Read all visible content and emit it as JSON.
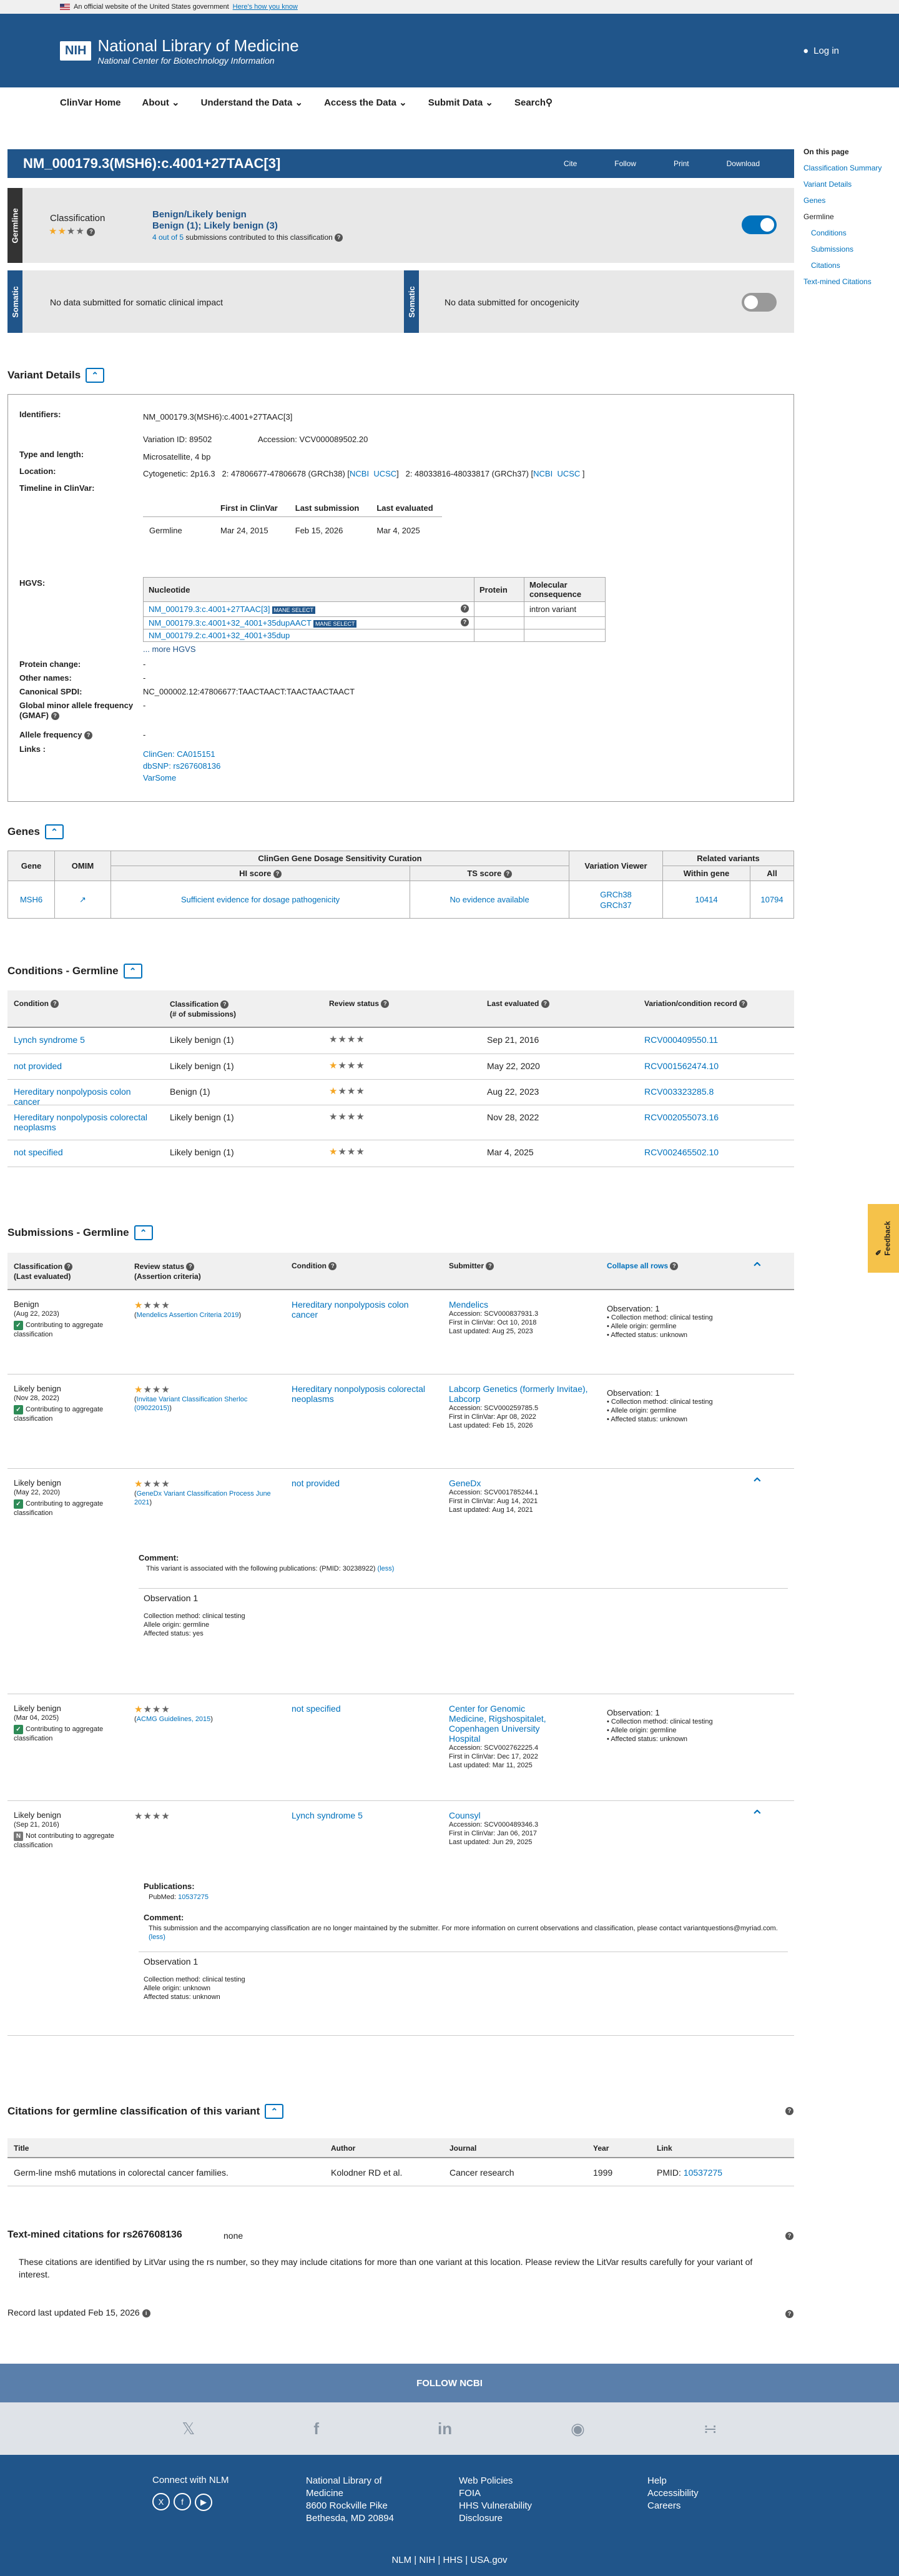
{
  "gov": {
    "text": "An official website of the United States government",
    "link": "Here's how you know"
  },
  "header": {
    "nih": "NIH",
    "name": "National Library of Medicine",
    "sub": "National Center for Biotechnology Information",
    "login": "Log in"
  },
  "nav": [
    "ClinVar Home",
    "About",
    "Understand the Data",
    "Access the Data",
    "Submit Data",
    "Search"
  ],
  "rail": {
    "heading": "On this page",
    "items": [
      "Classification Summary",
      "Variant Details",
      "Genes"
    ],
    "germline": "Germline",
    "sub": [
      "Conditions",
      "Submissions",
      "Citations"
    ],
    "tm": "Text-mined Citations"
  },
  "title": {
    "variant": "NM_000179.3(MSH6):c.4001+27TAAC[3]",
    "actions": [
      "Cite",
      "Follow",
      "Print",
      "Download"
    ]
  },
  "germline": {
    "tab": "Germline",
    "label": "Classification",
    "cls": "Benign/Likely benign",
    "cls2": "Benign (1); Likely benign (3)",
    "subs_link": "4 out of 5",
    "subs_rest": " submissions contributed to this classification"
  },
  "somatic": {
    "tab": "Somatic",
    "clin": "No data submitted for somatic clinical impact",
    "tab2": "Somatic",
    "onco": "No data submitted for oncogenicity"
  },
  "vd": {
    "heading": "Variant Details",
    "identifiers_l": "Identifiers:",
    "identifiers": "NM_000179.3(MSH6):c.4001+27TAAC[3]",
    "vid": "Variation ID: 89502",
    "acc": "Accession: VCV000089502.20",
    "type_l": "Type and length:",
    "type": "Microsatellite, 4 bp",
    "loc_l": "Location:",
    "loc": "Cytogenetic: 2p16.3   2: 47806677-47806678 (GRCh38) [",
    "ncbi": "NCBI",
    "ucsc": "UCSC",
    "loc2": "]   2: 48033816-48033817 (GRCh37) [",
    "timeline_l": "Timeline in ClinVar:",
    "tl_h": [
      "First in ClinVar",
      "Last submission",
      "Last evaluated"
    ],
    "tl_row": [
      "Germline",
      "Mar 24, 2015",
      "Feb 15, 2026",
      "Mar 4, 2025"
    ],
    "hgvs_l": "HGVS:",
    "hgvs_h": [
      "Nucleotide",
      "Protein",
      "Molecular consequence"
    ],
    "hgvs": [
      "NM_000179.3:c.4001+27TAAC[3]",
      "NM_000179.3:c.4001+32_4001+35dupAACT",
      "NM_000179.2:c.4001+32_4001+35dup"
    ],
    "mane": "MANE SELECT",
    "mc": "intron variant",
    "more": "... more HGVS",
    "pc_l": "Protein change:",
    "pc": "-",
    "on_l": "Other names:",
    "on": "-",
    "spdi_l": "Canonical SPDI:",
    "spdi": "NC_000002.12:47806677:TAACTAACT:TAACTAACTAACT",
    "gmaf_l": "Global minor allele frequency (GMAF)",
    "gmaf": "-",
    "af_l": "Allele frequency",
    "af": "-",
    "links_l": "Links :",
    "links": [
      "ClinGen: CA015151",
      "dbSNP: rs267608136",
      "VarSome"
    ]
  },
  "genes": {
    "heading": "Genes",
    "h": [
      "Gene",
      "OMIM",
      "ClinGen Gene Dosage Sensitivity Curation",
      "HI score",
      "TS score",
      "Variation Viewer",
      "Related variants",
      "Within gene",
      "All"
    ],
    "row": [
      "MSH6",
      "Sufficient evidence for dosage pathogenicity",
      "No evidence available",
      "GRCh38",
      "GRCh37",
      "10414",
      "10794"
    ]
  },
  "cond": {
    "heading": "Conditions - Germline",
    "h": [
      "Condition",
      "Classification",
      "(# of submissions)",
      "Review status",
      "Last evaluated",
      "Variation/condition record"
    ],
    "rows": [
      [
        "Lynch syndrome 5",
        "Likely benign (1)",
        "Sep 21, 2016",
        "RCV000409550.11"
      ],
      [
        "not provided",
        "Likely benign (1)",
        "May 22, 2020",
        "RCV001562474.10"
      ],
      [
        "Hereditary nonpolyposis colon cancer",
        "Benign (1)",
        "Aug 22, 2023",
        "RCV003323285.8"
      ],
      [
        "Hereditary nonpolyposis colorectal neoplasms",
        "Likely benign (1)",
        "Nov 28, 2022",
        "RCV002055073.16"
      ],
      [
        "not specified",
        "Likely benign (1)",
        "Mar 4, 2025",
        "RCV002465502.10"
      ]
    ]
  },
  "subs": {
    "heading": "Submissions - Germline",
    "h": [
      "Classification",
      "(Last evaluated)",
      "Review status",
      "(Assertion criteria)",
      "Condition",
      "Submitter",
      "Collapse all rows"
    ],
    "contrib": "Contributing to aggregate classification",
    "noncontrib": "Not contributing to aggregate classification",
    "obs1": "Observation: 1",
    "cm": "Collection method: clinical testing",
    "ao": "Allele origin: germline",
    "as": "Affected status: unknown",
    "rows": [
      {
        "cls": "Benign",
        "date": "(Aug 22, 2023)",
        "crit": "Mendelics Assertion Criteria 2019",
        "cond": "Hereditary nonpolyposis colon cancer",
        "sub": "Mendelics",
        "acc": "Accession: SCV000837931.3",
        "first": "First in ClinVar: Oct 10, 2018",
        "last": "Last updated: Aug 25, 2023"
      },
      {
        "cls": "Likely benign",
        "date": "(Nov 28, 2022)",
        "crit": "Invitae Variant Classification Sherloc (09022015)",
        "cond": "Hereditary nonpolyposis colorectal neoplasms",
        "sub": "Labcorp Genetics (formerly Invitae), Labcorp",
        "acc": "Accession: SCV000259785.5",
        "first": "First in ClinVar: Apr 08, 2022",
        "last": "Last updated: Feb 15, 2026"
      },
      {
        "cls": "Likely benign",
        "date": "(May 22, 2020)",
        "crit": "GeneDx Variant Classification Process June 2021",
        "cond": "not provided",
        "sub": "GeneDx",
        "acc": "Accession: SCV001785244.1",
        "first": "First in ClinVar: Aug 14, 2021",
        "last": "Last updated: Aug 14, 2021",
        "comment_l": "Comment:",
        "comment": "This variant is associated with the following publications: (PMID: 30238922)",
        "less": "(less)",
        "obs": "Observation 1",
        "cm2": "Collection method: clinical testing",
        "ao2": "Allele origin: germline",
        "as2": "Affected status: yes"
      },
      {
        "cls": "Likely benign",
        "date": "(Mar 04, 2025)",
        "crit": "ACMG Guidelines, 2015",
        "cond": "not specified",
        "sub": "Center for Genomic Medicine, Rigshospitalet, Copenhagen University Hospital",
        "acc": "Accession: SCV002762225.4",
        "first": "First in ClinVar: Dec 17, 2022",
        "last": "Last updated: Mar 11, 2025"
      },
      {
        "cls": "Likely benign",
        "date": "(Sep 21, 2016)",
        "cond": "Lynch syndrome 5",
        "sub": "Counsyl",
        "acc": "Accession: SCV000489346.3",
        "first": "First in ClinVar: Jan 06, 2017",
        "last": "Last updated: Jun 29, 2025",
        "pub_l": "Publications:",
        "pubmed": "PubMed: ",
        "pmid": "10537275",
        "comment_l": "Comment:",
        "comment": "This submission and the accompanying classification are no longer maintained by the submitter. For more information on current observations and classification, please contact variantquestions@myriad.com.",
        "less": "(less)",
        "obs": "Observation 1",
        "cm2": "Collection method: clinical testing",
        "ao2": "Allele origin: unknown",
        "as2": "Affected status: unknown"
      }
    ]
  },
  "cit": {
    "heading": "Citations for germline classification of this variant",
    "h": [
      "Title",
      "Author",
      "Journal",
      "Year",
      "Link"
    ],
    "row": [
      "Germ-line msh6 mutations in colorectal cancer families.",
      "Kolodner RD et al.",
      "Cancer research",
      "1999",
      "PMID: ",
      "10537275"
    ]
  },
  "tm": {
    "heading": "Text-mined citations for rs267608136",
    "none": "none",
    "text": "These citations are identified by LitVar using the rs number, so they may include citations for more than one variant at this location. Please review the LitVar results carefully for your variant of interest."
  },
  "updated": "Record last updated Feb 15, 2026",
  "footer": {
    "follow": "FOLLOW NCBI",
    "connect": "Connect with NLM",
    "addr": [
      "National Library of",
      "Medicine",
      "8600 Rockville Pike",
      "Bethesda, MD 20894"
    ],
    "col3": [
      "Web Policies",
      "FOIA",
      "HHS Vulnerability",
      "Disclosure"
    ],
    "col4": [
      "Help",
      "Accessibility",
      "Careers"
    ],
    "bottom": [
      "NLM",
      "NIH",
      "HHS",
      "USA.gov"
    ]
  }
}
